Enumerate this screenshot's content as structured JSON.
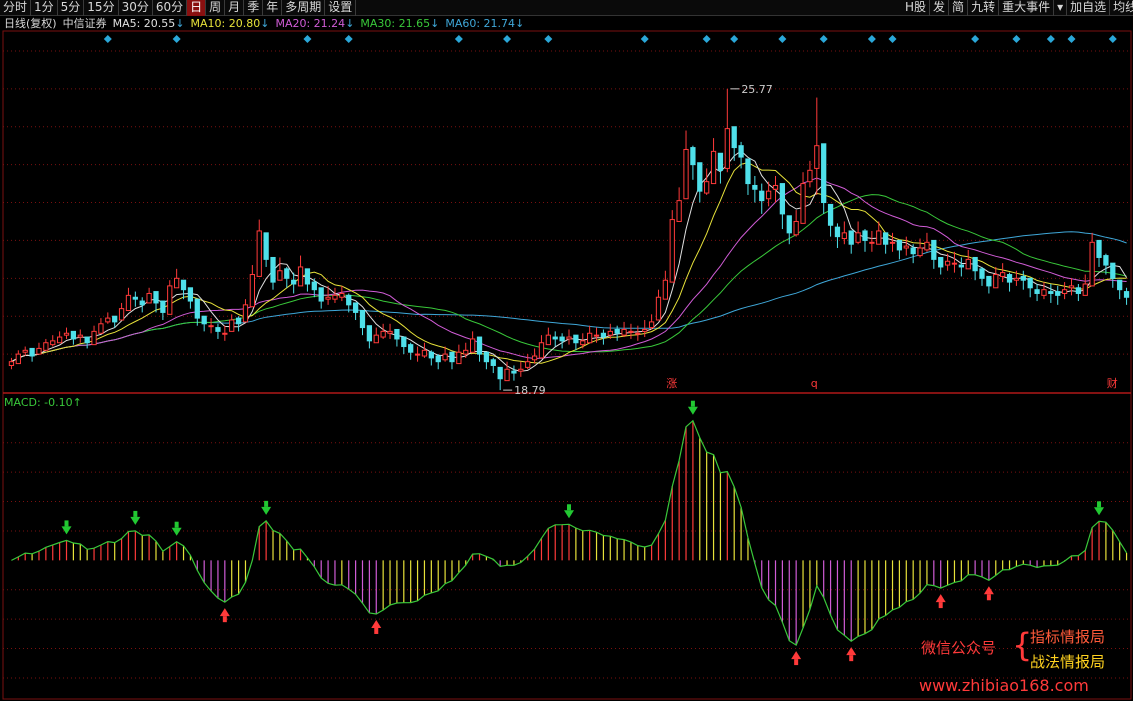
{
  "toolbar": {
    "left_tabs": [
      "分时",
      "1分",
      "5分",
      "15分",
      "30分",
      "60分",
      "日",
      "周",
      "月",
      "季",
      "年",
      "多周期",
      "设置"
    ],
    "active_tab": "日",
    "right_tabs": [
      "H股",
      "发",
      "简",
      "九转",
      "重大事件",
      "▾",
      "加自选",
      "均线"
    ]
  },
  "info": {
    "period": "日线(复权)",
    "stock": "中信证券",
    "ma": [
      {
        "label": "MA5: 20.55",
        "arrow": "↓",
        "color": "#e0e0e0"
      },
      {
        "label": "MA10: 20.80",
        "arrow": "↓",
        "color": "#e7e23a"
      },
      {
        "label": "MA20: 21.24",
        "arrow": "↓",
        "color": "#d05cd6"
      },
      {
        "label": "MA30: 21.65",
        "arrow": "↓",
        "color": "#39c83a"
      },
      {
        "label": "MA60: 21.74",
        "arrow": "↓",
        "color": "#3fa7d8"
      }
    ]
  },
  "macd_label": "MACD: -0.10↑",
  "watermark": {
    "wechat": "微信公众号",
    "brace": "{",
    "line1": "指标情报局",
    "line2": "战法情报局",
    "url": "www.zhibiao168.com"
  },
  "colors": {
    "up": "#ff3a3a",
    "down": "#4fe0ea",
    "grid": "#7a1010",
    "background": "#000000"
  },
  "chart_data": [
    {
      "type": "candlestick",
      "title": "中信证券 日线(复权)",
      "ylim": [
        18.0,
        27.5
      ],
      "annotations": [
        {
          "text": "25.77",
          "value": 25.77,
          "kind": "high"
        },
        {
          "text": "18.79",
          "value": 18.79,
          "kind": "low"
        },
        {
          "text": "涨",
          "kind": "event_marker"
        },
        {
          "text": "q",
          "kind": "event_marker"
        },
        {
          "text": "财",
          "kind": "event_marker"
        }
      ],
      "series": [
        {
          "name": "MA5",
          "value": 20.55
        },
        {
          "name": "MA10",
          "value": 20.8
        },
        {
          "name": "MA20",
          "value": 21.24
        },
        {
          "name": "MA30",
          "value": 21.65
        },
        {
          "name": "MA60",
          "value": 21.74
        }
      ],
      "close": [
        18.8,
        19.0,
        19.1,
        18.95,
        19.15,
        19.3,
        19.35,
        19.45,
        19.55,
        19.4,
        19.5,
        19.3,
        19.6,
        19.8,
        19.95,
        19.85,
        20.2,
        20.55,
        20.45,
        20.3,
        20.6,
        20.35,
        20.1,
        20.8,
        21.0,
        20.7,
        20.4,
        19.95,
        19.8,
        19.75,
        19.6,
        19.55,
        19.9,
        19.8,
        20.3,
        21.1,
        22.25,
        21.5,
        20.9,
        21.2,
        21.0,
        20.85,
        21.3,
        20.85,
        20.7,
        20.4,
        20.5,
        20.55,
        20.6,
        20.3,
        20.1,
        19.7,
        19.35,
        19.5,
        19.6,
        19.6,
        19.4,
        19.2,
        19.05,
        19.0,
        19.1,
        18.9,
        18.8,
        19.0,
        18.8,
        19.05,
        19.1,
        19.4,
        19.0,
        18.8,
        18.7,
        18.35,
        18.6,
        18.5,
        18.6,
        18.8,
        18.95,
        19.3,
        19.5,
        19.4,
        19.35,
        19.45,
        19.3,
        19.35,
        19.55,
        19.5,
        19.45,
        19.6,
        19.55,
        19.65,
        19.6,
        19.55,
        19.65,
        19.85,
        20.5,
        20.95,
        22.55,
        23.05,
        24.4,
        24.0,
        23.3,
        23.55,
        24.35,
        23.85,
        24.95,
        24.45,
        24.2,
        23.5,
        23.35,
        23.05,
        23.3,
        23.45,
        22.7,
        22.2,
        22.5,
        23.5,
        23.85,
        24.5,
        23.0,
        22.4,
        22.1,
        22.2,
        21.9,
        22.2,
        22.0,
        21.95,
        22.25,
        21.9,
        21.95,
        21.75,
        21.85,
        21.65,
        21.8,
        21.95,
        21.5,
        21.3,
        21.45,
        21.4,
        21.3,
        21.5,
        21.2,
        21.0,
        20.8,
        21.1,
        21.15,
        20.9,
        21.0,
        20.95,
        20.75,
        20.6,
        20.7,
        20.6,
        20.55,
        20.7,
        20.8,
        20.6,
        20.85,
        21.95,
        21.55,
        21.35,
        21.0,
        20.7,
        20.5
      ],
      "high": [
        18.9,
        19.1,
        19.2,
        19.1,
        19.3,
        19.4,
        19.5,
        19.6,
        19.7,
        19.5,
        19.65,
        19.45,
        19.75,
        19.95,
        20.1,
        20.0,
        20.35,
        20.75,
        20.65,
        20.5,
        20.75,
        20.55,
        20.3,
        20.95,
        21.25,
        20.9,
        20.6,
        20.2,
        20.0,
        19.95,
        19.8,
        19.75,
        20.05,
        20.0,
        20.45,
        21.35,
        22.55,
        22.0,
        21.4,
        21.55,
        21.3,
        21.15,
        21.6,
        21.2,
        21.0,
        20.7,
        20.8,
        20.75,
        20.8,
        20.6,
        20.35,
        20.0,
        19.55,
        19.7,
        19.8,
        19.8,
        19.6,
        19.45,
        19.3,
        19.2,
        19.3,
        19.1,
        19.0,
        19.2,
        19.0,
        19.25,
        19.3,
        19.6,
        19.3,
        19.05,
        18.9,
        18.6,
        18.8,
        18.7,
        18.8,
        19.0,
        19.15,
        19.5,
        19.7,
        19.6,
        19.55,
        19.65,
        19.5,
        19.55,
        19.75,
        19.7,
        19.65,
        19.8,
        19.75,
        19.85,
        19.8,
        19.75,
        19.9,
        20.05,
        20.7,
        21.2,
        22.8,
        23.4,
        24.9,
        24.5,
        23.8,
        23.9,
        24.7,
        24.3,
        26.0,
        24.95,
        24.6,
        24.0,
        23.7,
        23.5,
        23.55,
        23.7,
        23.1,
        22.6,
        22.8,
        23.8,
        24.1,
        25.77,
        24.1,
        22.8,
        22.45,
        22.5,
        22.25,
        22.5,
        22.3,
        22.25,
        22.5,
        22.2,
        22.2,
        22.0,
        22.1,
        21.9,
        22.05,
        22.2,
        21.8,
        21.55,
        21.65,
        21.7,
        21.55,
        21.75,
        21.45,
        21.3,
        21.05,
        21.3,
        21.4,
        21.15,
        21.2,
        21.2,
        21.0,
        20.85,
        20.9,
        20.85,
        20.8,
        20.9,
        21.0,
        20.85,
        21.1,
        22.2,
        21.85,
        21.65,
        21.3,
        20.95,
        20.75
      ],
      "low": [
        18.6,
        18.85,
        18.95,
        18.8,
        19.0,
        19.15,
        19.2,
        19.3,
        19.4,
        19.25,
        19.3,
        19.15,
        19.4,
        19.65,
        19.8,
        19.7,
        20.0,
        20.3,
        20.25,
        20.1,
        20.35,
        20.1,
        19.9,
        20.5,
        20.75,
        20.45,
        20.2,
        19.75,
        19.6,
        19.55,
        19.4,
        19.35,
        19.7,
        19.6,
        20.05,
        20.85,
        21.2,
        21.3,
        20.7,
        20.95,
        20.75,
        20.6,
        21.0,
        20.65,
        20.5,
        20.2,
        20.3,
        20.35,
        20.4,
        20.1,
        19.9,
        19.5,
        19.15,
        19.3,
        19.4,
        19.4,
        19.2,
        19.0,
        18.85,
        18.8,
        18.9,
        18.7,
        18.6,
        18.8,
        18.6,
        18.85,
        18.9,
        19.15,
        18.8,
        18.6,
        18.5,
        18.05,
        18.4,
        18.3,
        18.4,
        18.6,
        18.75,
        19.1,
        19.3,
        19.2,
        19.15,
        19.25,
        19.1,
        19.15,
        19.35,
        19.3,
        19.25,
        19.4,
        19.35,
        19.45,
        19.4,
        19.35,
        19.45,
        19.65,
        20.25,
        20.7,
        21.0,
        22.6,
        23.3,
        23.6,
        23.0,
        23.2,
        23.6,
        23.5,
        23.8,
        24.1,
        23.9,
        23.2,
        23.0,
        22.7,
        22.9,
        23.0,
        22.3,
        21.9,
        22.1,
        22.9,
        23.4,
        23.2,
        22.7,
        22.1,
        21.8,
        21.9,
        21.65,
        21.9,
        21.7,
        21.7,
        21.95,
        21.65,
        21.7,
        21.5,
        21.6,
        21.4,
        21.55,
        21.7,
        21.25,
        21.1,
        21.2,
        21.15,
        21.05,
        21.25,
        20.95,
        20.8,
        20.6,
        20.85,
        20.9,
        20.65,
        20.8,
        20.7,
        20.5,
        20.4,
        20.45,
        20.35,
        20.3,
        20.45,
        20.55,
        20.4,
        20.6,
        21.6,
        21.3,
        21.1,
        20.75,
        20.45,
        20.3
      ]
    },
    {
      "type": "bar",
      "title": "MACD",
      "ylim": [
        -0.95,
        1.05
      ],
      "annotations": [
        {
          "text": "MACD: -0.10↑",
          "value": -0.1
        }
      ]
    }
  ]
}
